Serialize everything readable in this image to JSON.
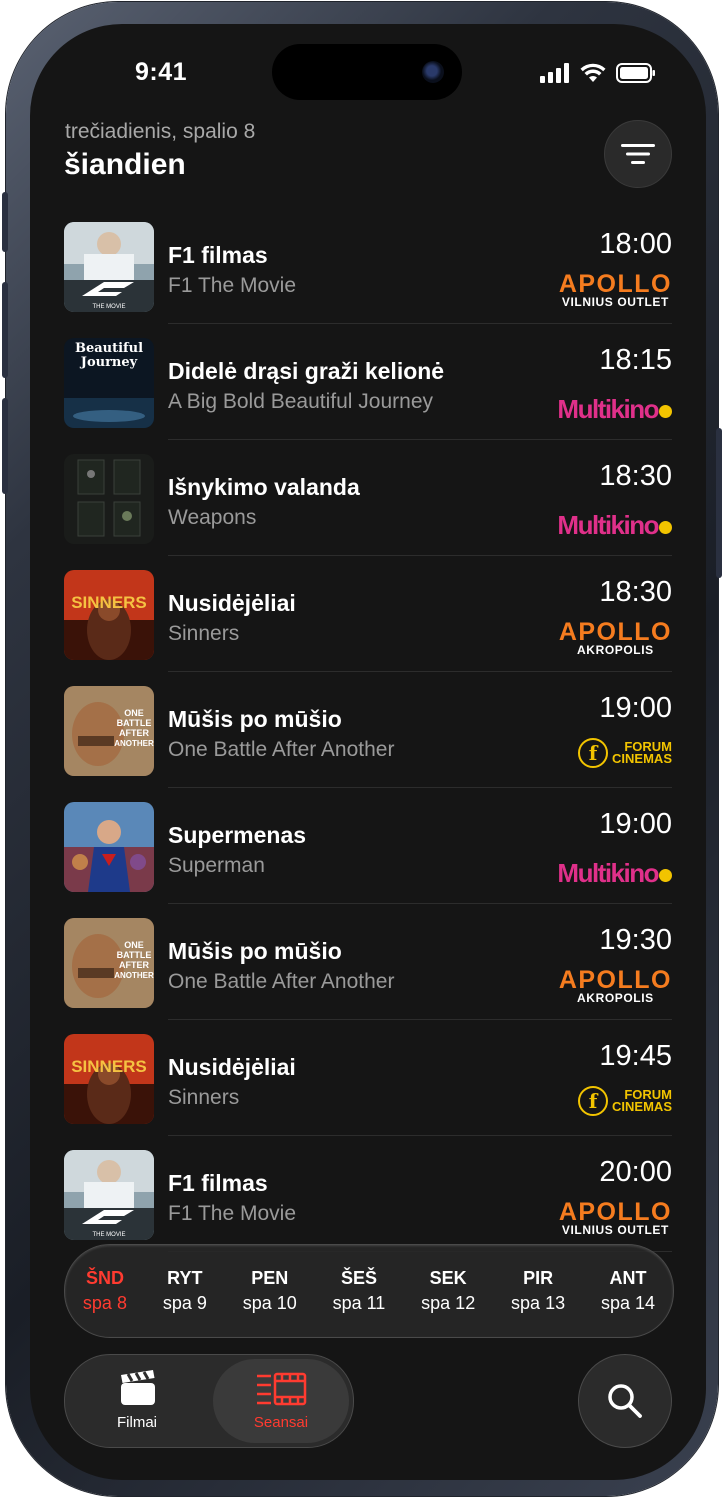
{
  "status_bar": {
    "time": "9:41"
  },
  "header": {
    "date": "trečiadienis, spalio 8",
    "title": "šiandien"
  },
  "screenings": [
    {
      "title": "F1 filmas",
      "original": "F1 The Movie",
      "time": "18:00",
      "cinema": "apollo",
      "logo_main": "APOLLO",
      "logo_sub": "VILNIUS OUTLET",
      "poster": "f1"
    },
    {
      "title": "Didelė drąsi graži kelionė",
      "original": "A Big Bold Beautiful Journey",
      "time": "18:15",
      "cinema": "multikino",
      "logo_main": "Multikino",
      "poster": "journey"
    },
    {
      "title": "Išnykimo valanda",
      "original": "Weapons",
      "time": "18:30",
      "cinema": "multikino",
      "logo_main": "Multikino",
      "poster": "weapons"
    },
    {
      "title": "Nusidėjėliai",
      "original": "Sinners",
      "time": "18:30",
      "cinema": "apollo",
      "logo_main": "APOLLO",
      "logo_sub": "AKROPOLIS",
      "poster": "sinners"
    },
    {
      "title": "Mūšis po mūšio",
      "original": "One Battle After Another",
      "time": "19:00",
      "cinema": "forum",
      "logo_main": "FORUM",
      "logo_sub": "CINEMAS",
      "poster": "battle"
    },
    {
      "title": "Supermenas",
      "original": "Superman",
      "time": "19:00",
      "cinema": "multikino",
      "logo_main": "Multikino",
      "poster": "superman"
    },
    {
      "title": "Mūšis po mūšio",
      "original": "One Battle After Another",
      "time": "19:30",
      "cinema": "apollo",
      "logo_main": "APOLLO",
      "logo_sub": "AKROPOLIS",
      "poster": "battle"
    },
    {
      "title": "Nusidėjėliai",
      "original": "Sinners",
      "time": "19:45",
      "cinema": "forum",
      "logo_main": "FORUM",
      "logo_sub": "CINEMAS",
      "poster": "sinners"
    },
    {
      "title": "F1 filmas",
      "original": "F1 The Movie",
      "time": "20:00",
      "cinema": "apollo",
      "logo_main": "APOLLO",
      "logo_sub": "VILNIUS OUTLET",
      "poster": "f1"
    }
  ],
  "date_selector": [
    {
      "day": "ŠND",
      "date": "spa 8",
      "selected": true
    },
    {
      "day": "RYT",
      "date": "spa 9"
    },
    {
      "day": "PEN",
      "date": "spa 10"
    },
    {
      "day": "ŠEŠ",
      "date": "spa 11"
    },
    {
      "day": "SEK",
      "date": "spa 12"
    },
    {
      "day": "PIR",
      "date": "spa 13"
    },
    {
      "day": "ANT",
      "date": "spa 14"
    }
  ],
  "tabs": [
    {
      "label": "Filmai",
      "icon": "clapperboard-icon"
    },
    {
      "label": "Seansai",
      "icon": "film-schedule-icon",
      "active": true
    }
  ],
  "colors": {
    "accent": "#ff3b30",
    "apollo": "#f57c1f",
    "multikino": "#e0308a",
    "forum": "#f2c400",
    "background": "#151515"
  }
}
